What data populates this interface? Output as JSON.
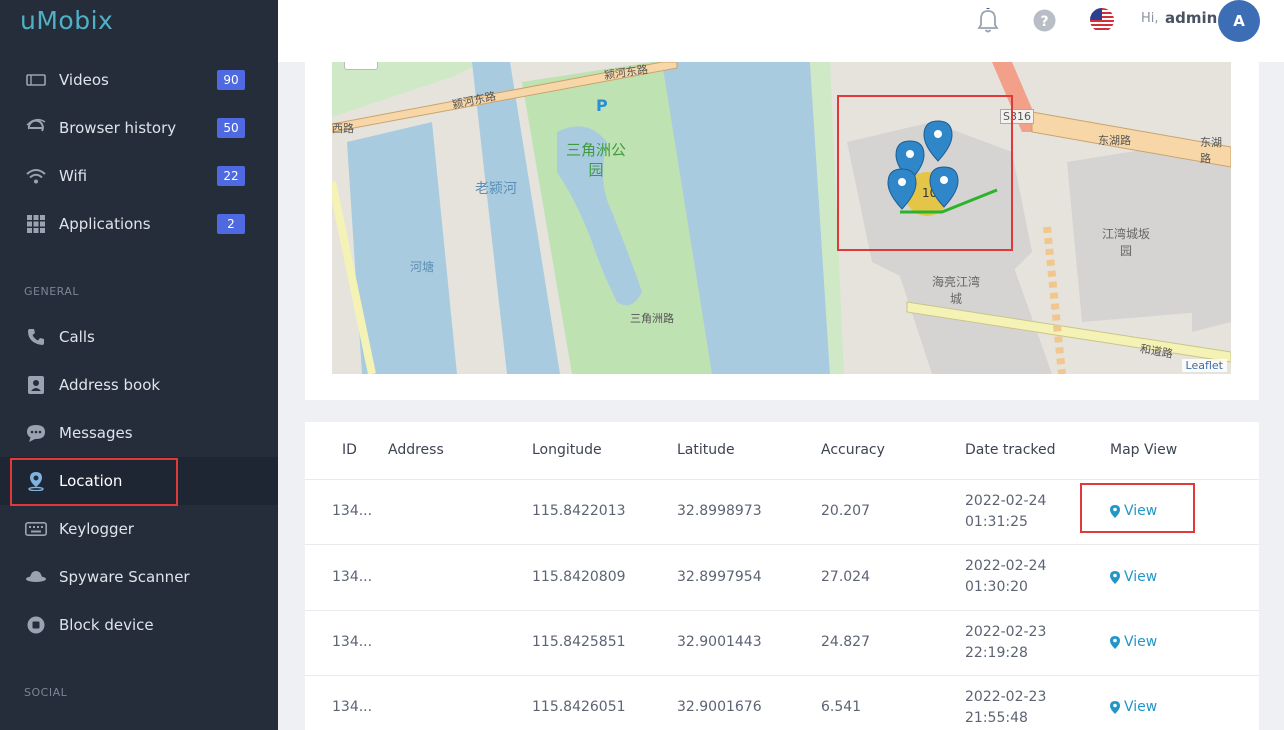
{
  "app": {
    "logo": "uMobix"
  },
  "sidebar": {
    "items_top": [
      {
        "label": "Videos",
        "badge": "90",
        "icon": "video-icon"
      },
      {
        "label": "Browser history",
        "badge": "50",
        "icon": "browser-icon"
      },
      {
        "label": "Wifi",
        "badge": "22",
        "icon": "wifi-icon"
      },
      {
        "label": "Applications",
        "badge": "2",
        "icon": "grid-icon"
      }
    ],
    "general_label": "GENERAL",
    "items_general": [
      {
        "label": "Calls",
        "icon": "phone-icon"
      },
      {
        "label": "Address book",
        "icon": "contacts-icon"
      },
      {
        "label": "Messages",
        "icon": "chat-icon"
      },
      {
        "label": "Location",
        "icon": "location-pin-icon"
      },
      {
        "label": "Keylogger",
        "icon": "keyboard-icon"
      },
      {
        "label": "Spyware Scanner",
        "icon": "spy-hat-icon"
      },
      {
        "label": "Block device",
        "icon": "block-icon"
      }
    ],
    "social_label": "SOCIAL"
  },
  "header": {
    "hi": "Hi,",
    "user": "admin",
    "avatar_letter": "A"
  },
  "map": {
    "labels": {
      "park": "三角洲公\n园",
      "river": "老颍河",
      "pond": "河塘",
      "district": "海亮江湾\n城",
      "park2": "江湾城坂\n园",
      "road_s316": "S316",
      "road_east": "东湖路",
      "road_east2": "东湖路",
      "road_west": "颍河东路",
      "road_west2": "颍河东路",
      "road_w": "西路",
      "road_sjz": "三角洲路",
      "road_he": "和道路",
      "cluster_count": "10",
      "parking": "P",
      "leaflet": "Leaflet"
    }
  },
  "table": {
    "headers": [
      "ID",
      "Address",
      "Longitude",
      "Latitude",
      "Accuracy",
      "Date tracked",
      "Map View"
    ],
    "rows": [
      {
        "id": "134...",
        "address": "",
        "lon": "115.8422013",
        "lat": "32.8998973",
        "acc": "20.207",
        "date1": "2022-02-24",
        "date2": "01:31:25",
        "view": "View"
      },
      {
        "id": "134...",
        "address": "",
        "lon": "115.8420809",
        "lat": "32.8997954",
        "acc": "27.024",
        "date1": "2022-02-24",
        "date2": "01:30:20",
        "view": "View"
      },
      {
        "id": "134...",
        "address": "",
        "lon": "115.8425851",
        "lat": "32.9001443",
        "acc": "24.827",
        "date1": "2022-02-23",
        "date2": "22:19:28",
        "view": "View"
      },
      {
        "id": "134...",
        "address": "",
        "lon": "115.8426051",
        "lat": "32.9001676",
        "acc": "6.541",
        "date1": "2022-02-23",
        "date2": "21:55:48",
        "view": "View"
      }
    ]
  }
}
